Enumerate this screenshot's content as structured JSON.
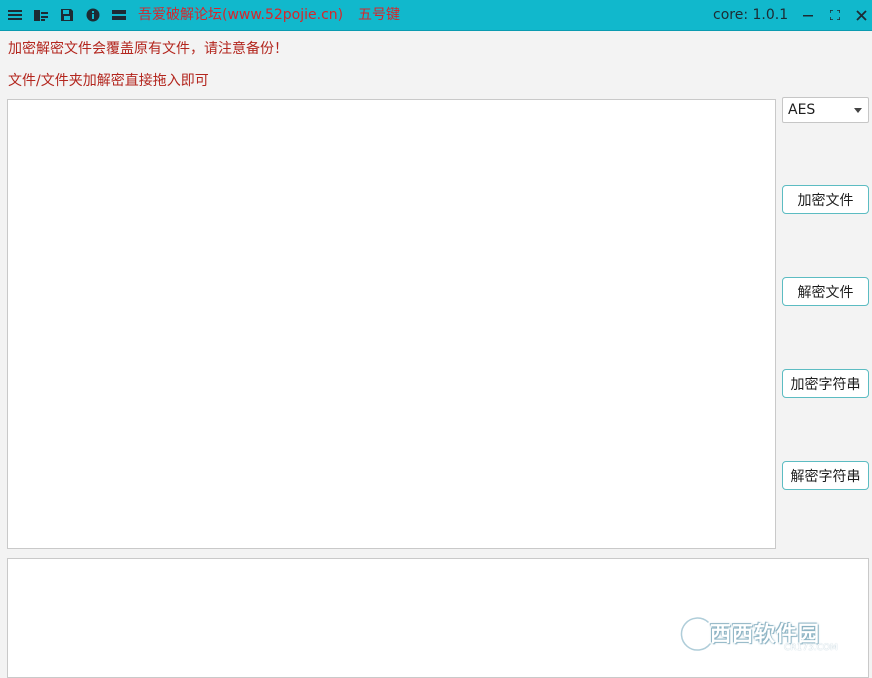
{
  "titlebar": {
    "icons": [
      "menu-icon",
      "folder-files-icon",
      "save-icon",
      "info-icon",
      "list-icon"
    ],
    "link_forum": "吾爱破解论坛(www.52pojie.cn)",
    "link_author": "五号键",
    "core_version": "core: 1.0.1",
    "colors": {
      "background": "#11b8cc",
      "link": "#d8262b"
    }
  },
  "notices": {
    "overwrite_warning": "加密解密文件会覆盖原有文件，请注意备份！",
    "drag_hint": "文件/文件夹加解密直接拖入即可"
  },
  "input_area": {
    "value": ""
  },
  "output_area": {
    "value": ""
  },
  "algorithm": {
    "selected": "AES"
  },
  "actions": {
    "encrypt_file": "加密文件",
    "decrypt_file": "解密文件",
    "encrypt_string": "加密字符串",
    "decrypt_string": "解密字符串"
  },
  "watermark": {
    "text": "西西软件园",
    "sub": "CR173.COM"
  }
}
